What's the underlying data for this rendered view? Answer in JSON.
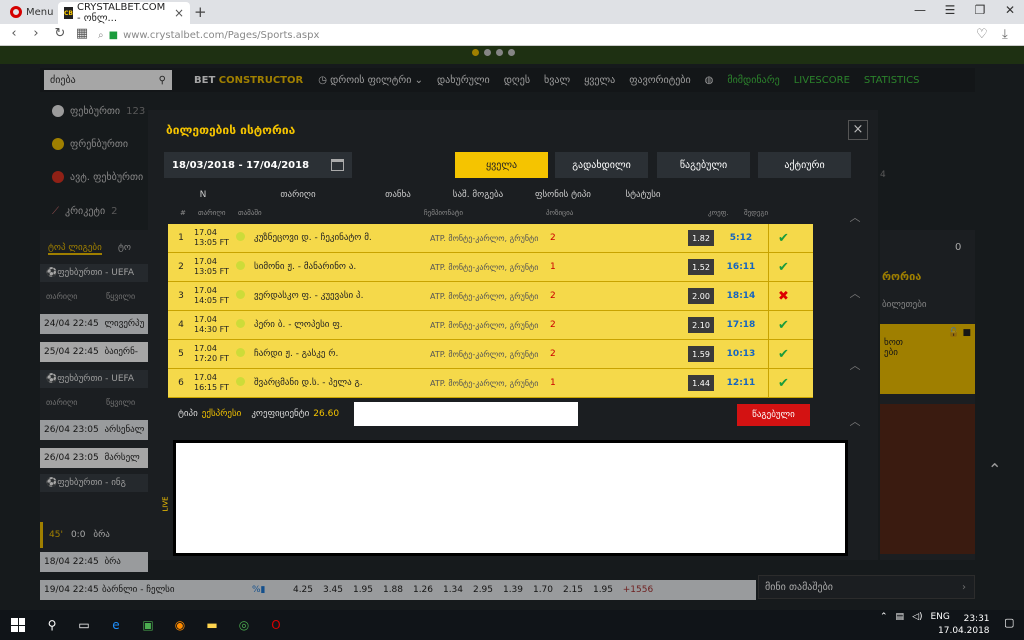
{
  "browser": {
    "menu_label": "Menu",
    "tab_title": "CRYSTALBET.COM - ონლ...",
    "url_host": "www.crystalbet.com",
    "url_path": "/Pages/Sports.aspx"
  },
  "site_nav": {
    "search_placeholder": "ძიება",
    "bet_constructor_prefix": "BET ",
    "bet_constructor_highlight": "CONSTRUCTOR",
    "time_filter": "დროის ფილტრი",
    "items": [
      "დახურული",
      "დღეს",
      "ხვალ",
      "ყველა",
      "ფავორიტები"
    ],
    "green_items": [
      "მიმდინარე",
      "LIVESCORE",
      "STATISTICS"
    ]
  },
  "left_sports": [
    {
      "label": "ფეხბურთი",
      "count": "123"
    },
    {
      "label": "ფრენბურთი",
      "count": ""
    },
    {
      "label": "ავტ. ფეხბურთი",
      "count": ""
    },
    {
      "label": "კრიკეტი",
      "count": "2"
    }
  ],
  "left_panel": {
    "tab": "ტოპ ლიგები",
    "tab2": "ტო",
    "league1": "ფეხბურთი - UEFA",
    "league2": "ფეხბურთი - UEFA",
    "league3": "ფეხბურთი - ინგ",
    "col_date": "თარიღი",
    "col_pair": "წყვილი",
    "rows1": [
      {
        "date": "24/04 22:45",
        "pair": "ლივერპუ"
      },
      {
        "date": "25/04 22:45",
        "pair": "ბაიერნ-"
      }
    ],
    "rows2": [
      {
        "date": "26/04 23:05",
        "pair": "არსენალ"
      },
      {
        "date": "26/04 23:05",
        "pair": "მარსელ"
      }
    ],
    "live_minute": "45'",
    "live_score": "0:0",
    "live_pair": "ბრა",
    "rows3": [
      {
        "date": "18/04 22:45",
        "pair": "ბრა"
      }
    ]
  },
  "bottom_row": {
    "date": "19/04 22:45",
    "pair": "ბარნლი - ჩელსი",
    "odds": [
      "4.25",
      "3.45",
      "1.95",
      "1.88",
      "1.26",
      "1.34",
      "2.95",
      "1.39",
      "1.70",
      "2.15",
      "1.95"
    ],
    "more": "+1556"
  },
  "right_col": {
    "title_fragment": "რორია",
    "sub": "ბილეთები",
    "count": "4",
    "zero": "0",
    "promo1": "ხოთ",
    "promo2": "ები"
  },
  "mini_games": "მინი თამაშები",
  "modal": {
    "title": "ბილეთების ისტორია",
    "date_range": "18/03/2018 - 17/04/2018",
    "filters": [
      "ყველა",
      "გადახდილი",
      "წაგებული",
      "აქტიური"
    ],
    "columns": [
      "N",
      "თარიღი",
      "თანხა",
      "საშ. მოგება",
      "ფსონის ტიპი",
      "სტატუსი"
    ],
    "sub_columns": [
      "#",
      "თარიღი",
      "თამაში",
      "ჩემპიონატი",
      "პოზიცია",
      "კოეფ.",
      "შედეგი"
    ],
    "rows": [
      {
        "n": "1",
        "date": "17.04",
        "time": "13:05 FT",
        "teams": "კუზნეცოვი დ. - ჩეკინატო მ.",
        "tournament": "ATP. მონტე-კარლო, გრუნტი",
        "pick": "2",
        "odd": "1.82",
        "score": "5:12",
        "status": "win"
      },
      {
        "n": "2",
        "date": "17.04",
        "time": "13:05 FT",
        "teams": "სიმონი ჟ. - მანარინო ა.",
        "tournament": "ATP. მონტე-კარლო, გრუნტი",
        "pick": "1",
        "odd": "1.52",
        "score": "16:11",
        "status": "win"
      },
      {
        "n": "3",
        "date": "17.04",
        "time": "14:05 FT",
        "teams": "ვერდასკო ფ. - კუევასი პ.",
        "tournament": "ATP. მონტე-კარლო, გრუნტი",
        "pick": "2",
        "odd": "2.00",
        "score": "18:14",
        "status": "loss"
      },
      {
        "n": "4",
        "date": "17.04",
        "time": "14:30 FT",
        "teams": "პერი ბ. - ლოპესი ფ.",
        "tournament": "ATP. მონტე-კარლო, გრუნტი",
        "pick": "2",
        "odd": "2.10",
        "score": "17:18",
        "status": "win"
      },
      {
        "n": "5",
        "date": "17.04",
        "time": "17:20 FT",
        "teams": "ჩარდი ჟ. - გასკე რ.",
        "tournament": "ATP. მონტე-კარლო, გრუნტი",
        "pick": "2",
        "odd": "1.59",
        "score": "10:13",
        "status": "win"
      },
      {
        "n": "6",
        "date": "17.04",
        "time": "16:15 FT",
        "teams": "შვარცმანი დ.ს. - პელა გ.",
        "tournament": "ATP. მონტე-კარლო, გრუნტი",
        "pick": "1",
        "odd": "1.44",
        "score": "12:11",
        "status": "win"
      }
    ],
    "summary_type_label": "ტიპი",
    "summary_type_value": "ექსპრესი",
    "summary_odd_label": "კოეფიციენტი",
    "summary_odd_value": "26.60",
    "lost_button": "წაგებული",
    "live_label": "LIVE"
  },
  "taskbar": {
    "lang": "ENG",
    "time": "23:31",
    "date": "17.04.2018"
  },
  "colors": {
    "accent": "#f5c400",
    "win": "#1a9c3c",
    "loss": "#d00000",
    "lost_button": "#d31212"
  }
}
